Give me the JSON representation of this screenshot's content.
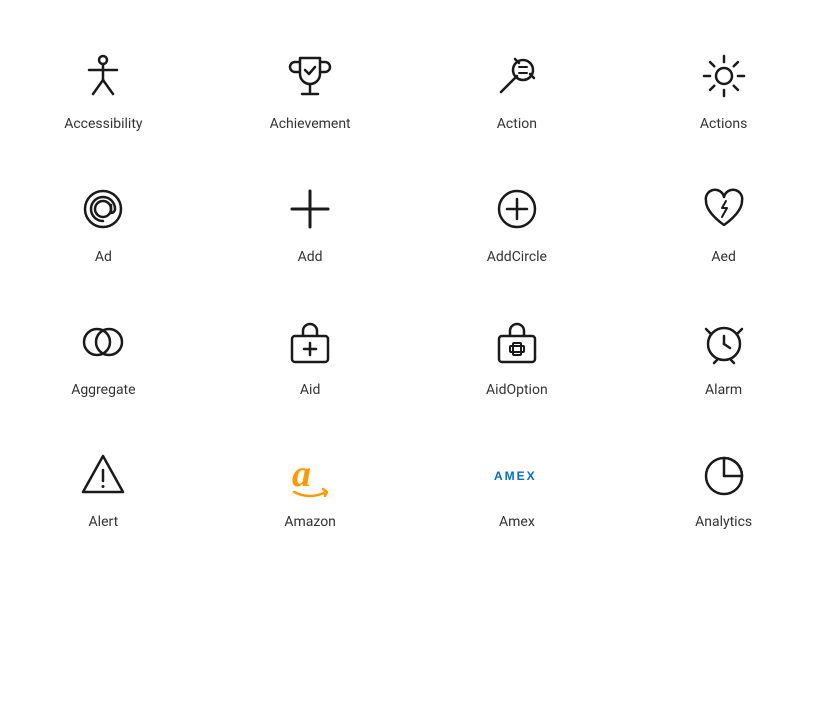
{
  "icons": [
    {
      "name": "Accessibility",
      "id": "accessibility"
    },
    {
      "name": "Achievement",
      "id": "achievement"
    },
    {
      "name": "Action",
      "id": "action"
    },
    {
      "name": "Actions",
      "id": "actions"
    },
    {
      "name": "Ad",
      "id": "ad"
    },
    {
      "name": "Add",
      "id": "add"
    },
    {
      "name": "AddCircle",
      "id": "addcircle"
    },
    {
      "name": "Aed",
      "id": "aed"
    },
    {
      "name": "Aggregate",
      "id": "aggregate"
    },
    {
      "name": "Aid",
      "id": "aid"
    },
    {
      "name": "AidOption",
      "id": "aidoption"
    },
    {
      "name": "Alarm",
      "id": "alarm"
    },
    {
      "name": "Alert",
      "id": "alert"
    },
    {
      "name": "Amazon",
      "id": "amazon"
    },
    {
      "name": "Amex",
      "id": "amex"
    },
    {
      "name": "Analytics",
      "id": "analytics"
    }
  ]
}
